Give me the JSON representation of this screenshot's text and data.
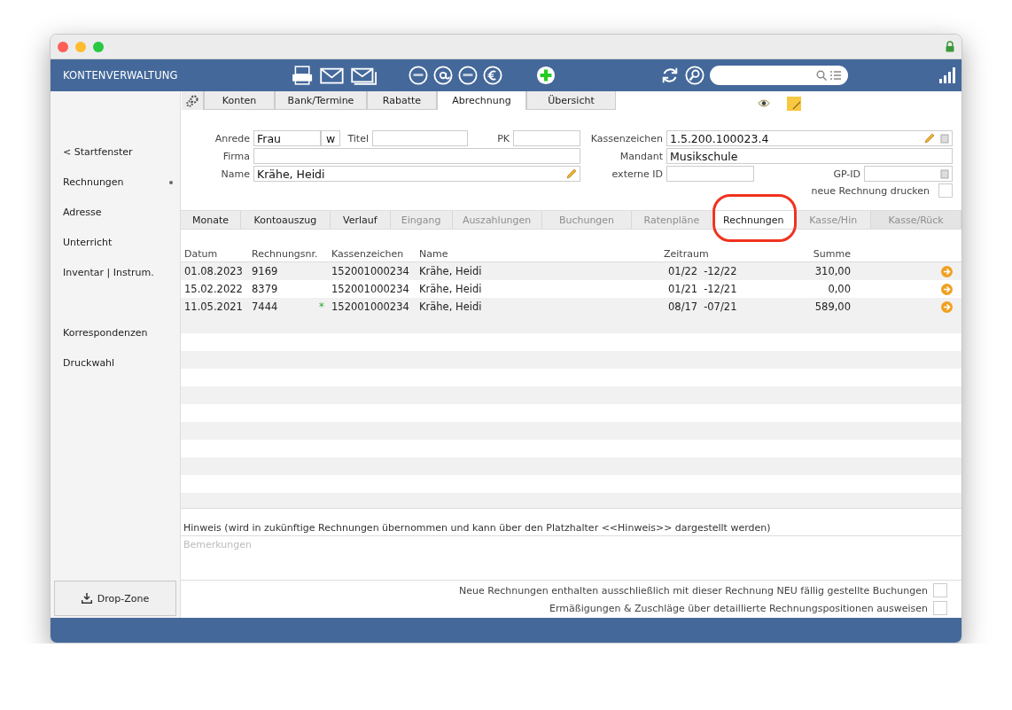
{
  "window": {
    "title": "KONTENVERWALTUNG"
  },
  "sidebar": {
    "items": [
      {
        "label": "< Startfenster",
        "selected": false
      },
      {
        "label": "Rechnungen",
        "selected": true
      },
      {
        "label": "Adresse",
        "selected": false
      },
      {
        "label": "Unterricht",
        "selected": false
      },
      {
        "label": "Inventar | Instrum.",
        "selected": false
      },
      {
        "label": "Korrespondenzen",
        "selected": false
      },
      {
        "label": "Druckwahl",
        "selected": false
      }
    ],
    "drop_zone": "Drop-Zone"
  },
  "tabs": [
    {
      "label": "Konten",
      "selected": false
    },
    {
      "label": "Bank/Termine",
      "selected": false
    },
    {
      "label": "Rabatte",
      "selected": false
    },
    {
      "label": "Abrechnung",
      "selected": true
    },
    {
      "label": "Übersicht",
      "selected": false
    }
  ],
  "form": {
    "anrede": {
      "label": "Anrede",
      "value": "Frau",
      "suffix": "w"
    },
    "titel": {
      "label": "Titel"
    },
    "pk": {
      "label": "PK"
    },
    "firma": {
      "label": "Firma"
    },
    "name": {
      "label": "Name",
      "value": "Krähe, Heidi"
    },
    "kassenzeichen": {
      "label": "Kassenzeichen",
      "value": "1.5.200.100023.4"
    },
    "mandant": {
      "label": "Mandant",
      "value": "Musikschule"
    },
    "externe_id": {
      "label": "externe ID"
    },
    "gp_id": {
      "label": "GP-ID"
    },
    "neue_rechnung_drucken": {
      "label": "neue Rechnung drucken",
      "checked": false
    }
  },
  "subtabs": [
    {
      "label": "Monate",
      "selected": false,
      "disabled": false,
      "circled": false
    },
    {
      "label": "Kontoauszug",
      "selected": false,
      "disabled": false,
      "circled": false
    },
    {
      "label": "Verlauf",
      "selected": false,
      "disabled": false,
      "circled": false
    },
    {
      "label": "Eingang",
      "selected": false,
      "disabled": true,
      "circled": false
    },
    {
      "label": "Auszahlungen",
      "selected": false,
      "disabled": true,
      "circled": false
    },
    {
      "label": "Buchungen",
      "selected": false,
      "disabled": true,
      "circled": false
    },
    {
      "label": "Ratenpläne",
      "selected": false,
      "disabled": true,
      "circled": false
    },
    {
      "label": "Rechnungen",
      "selected": true,
      "disabled": false,
      "circled": true
    },
    {
      "label": "Kasse/Hin",
      "selected": false,
      "disabled": true,
      "circled": false
    },
    {
      "label": "Kasse/Rück",
      "selected": false,
      "disabled": true,
      "circled": false
    }
  ],
  "table": {
    "columns": [
      "Datum",
      "Rechnungsnr.",
      "Kassenzeichen",
      "Name",
      "Zeitraum",
      "Summe"
    ],
    "rows": [
      {
        "datum": "01.08.2023",
        "rechnungsnr": "9169",
        "kassenzeichen": "152001000234",
        "name": "Krähe, Heidi",
        "von": "01/22",
        "bis": "-12/22",
        "summe": "310,00"
      },
      {
        "datum": "15.02.2022",
        "rechnungsnr": "8379",
        "kassenzeichen": "152001000234",
        "name": "Krähe, Heidi",
        "von": "01/21",
        "bis": "-12/21",
        "summe": "0,00"
      },
      {
        "datum": "11.05.2021",
        "rechnungsnr": "7444",
        "mark": "*",
        "kassenzeichen": "152001000234",
        "name": "Krähe, Heidi",
        "von": "08/17",
        "bis": "-07/21",
        "summe": "589,00"
      }
    ]
  },
  "hinweis": "Hinweis (wird in zukünftige Rechnungen übernommen und kann über den Platzhalter <<Hinweis>> dargestellt werden)",
  "bemerkungen": {
    "placeholder": "Bemerkungen"
  },
  "options": [
    {
      "label": "Neue Rechnungen enthalten ausschließlich mit dieser Rechnung NEU fällig gestellte Buchungen",
      "checked": false
    },
    {
      "label": "Ermäßigungen & Zuschläge über detaillierte Rechnungspositionen ausweisen",
      "checked": false
    }
  ]
}
